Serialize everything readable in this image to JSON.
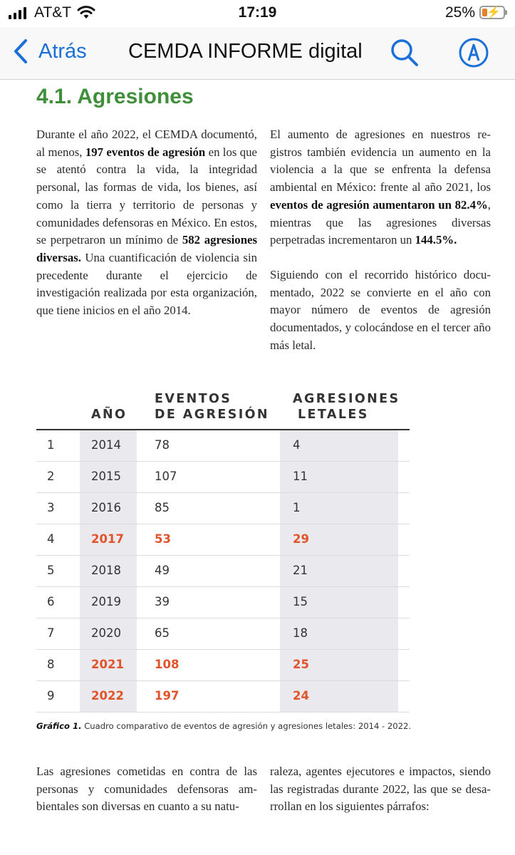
{
  "status_bar": {
    "carrier": "AT&T",
    "time": "17:19",
    "battery_percent": "25%",
    "battery_level": 0.25,
    "signal_icon": "signal-bars-icon",
    "wifi_icon": "wifi-icon",
    "battery_icon": "battery-charging-icon"
  },
  "nav": {
    "back_label": "Atrás",
    "title": "CEMDA INFORME digital",
    "search_icon": "search-icon",
    "markup_icon": "markup-pen-icon",
    "accent_color": "#1a6fd8"
  },
  "section": {
    "title": "4.1. Agresiones",
    "title_color": "#3f8f3a"
  },
  "intro_left": {
    "t1": "Durante el año 2022, el CEMDA documen­tó, al menos, ",
    "b1": "197 eventos de agresión",
    "t2": " en los que se atentó contra la vida, la integri­dad personal, las formas de vida, los bie­nes, así como la tierra y territorio de perso­nas y comunidades defensoras en México. En estos, se perpetraron un mínimo de ",
    "b2": "582 agresiones diversas.",
    "t3": " Una cuantifica­ción de violencia sin precedente durante el ejercicio de investigación realizada por esta organización, que tiene inicios en el año 2014."
  },
  "intro_right": {
    "p1_t1": "El aumento de agresiones en nuestros re­gistros también evidencia un aumento en la violencia a la que se enfrenta la defensa ambiental en México: frente al año 2021, los ",
    "p1_b1": "eventos de agresión aumentaron un 82.4%",
    "p1_t2": ", mientras que las agresiones diver­sas perpetradas incrementaron un ",
    "p1_b2": "144.5%.",
    "p2": "Siguiendo con el recorrido histórico docu­mentado, 2022 se convierte en el año con mayor número de eventos de agresión documentados, y colocándose en el tercer año más letal."
  },
  "table": {
    "headers": {
      "year": "AÑO",
      "events_line1": "EVENTOS",
      "events_line2": "DE AGRESIÓN",
      "lethal_line1": "AGRESIONES",
      "lethal_line2": "LETALES"
    },
    "highlight_color": "#e1542b",
    "rows": [
      {
        "idx": "1",
        "year": "2014",
        "events": "78",
        "lethal": "4",
        "highlight": false
      },
      {
        "idx": "2",
        "year": "2015",
        "events": "107",
        "lethal": "11",
        "highlight": false
      },
      {
        "idx": "3",
        "year": "2016",
        "events": "85",
        "lethal": "1",
        "highlight": false
      },
      {
        "idx": "4",
        "year": "2017",
        "events": "53",
        "lethal": "29",
        "highlight": true
      },
      {
        "idx": "5",
        "year": "2018",
        "events": "49",
        "lethal": "21",
        "highlight": false
      },
      {
        "idx": "6",
        "year": "2019",
        "events": "39",
        "lethal": "15",
        "highlight": false
      },
      {
        "idx": "7",
        "year": "2020",
        "events": "65",
        "lethal": "18",
        "highlight": false
      },
      {
        "idx": "8",
        "year": "2021",
        "events": "108",
        "lethal": "25",
        "highlight": true
      },
      {
        "idx": "9",
        "year": "2022",
        "events": "197",
        "lethal": "24",
        "highlight": true
      }
    ]
  },
  "caption": {
    "label": "Gráfico 1.",
    "text": " Cuadro comparativo de eventos de agresión y agresiones letales: 2014 - 2022."
  },
  "closing_left": "Las agresiones cometidas en contra de las personas y comunidades defensoras am­bientales son diversas en cuanto a su natu-",
  "closing_right": "raleza, agentes ejecutores e impactos, siendo las registradas durante 2022, las que se desa­rrollan en los siguientes párrafos:"
}
